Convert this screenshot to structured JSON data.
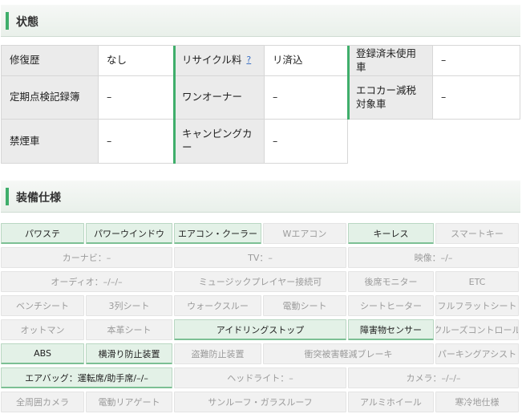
{
  "status_section": {
    "title": "状態"
  },
  "status_rows": [
    [
      {
        "label": "修復歴",
        "value": "なし"
      },
      {
        "label": "リサイクル料",
        "help": "?",
        "value": "リ済込"
      },
      {
        "label": "登録済未使用車",
        "value": "–"
      }
    ],
    [
      {
        "label": "定期点検記録簿",
        "value": "–"
      },
      {
        "label": "ワンオーナー",
        "value": "–"
      },
      {
        "label": "エコカー減税対象車",
        "value": "–"
      }
    ],
    [
      {
        "label": "禁煙車",
        "value": "–"
      },
      {
        "label": "キャンピングカー",
        "value": "–"
      }
    ]
  ],
  "equipment_section": {
    "title": "装備仕様"
  },
  "equipment_rows": [
    [
      {
        "label": "パワステ",
        "active": true
      },
      {
        "label": "パワーウインドウ",
        "active": true
      },
      {
        "label": "エアコン・クーラー",
        "active": true
      },
      {
        "label": "Wエアコン",
        "active": false
      },
      {
        "label": "キーレス",
        "active": true
      },
      {
        "label": "スマートキー",
        "active": false
      }
    ],
    [
      {
        "label": "カーナビ：–",
        "active": false
      },
      {
        "label": "TV：–",
        "active": false
      },
      {
        "label": "映像：–/–",
        "active": false
      }
    ],
    [
      {
        "label": "オーディオ：–/–/–",
        "active": false
      },
      {
        "label": "ミュージックプレイヤー接続可",
        "active": false
      },
      {
        "label": "後席モニター",
        "active": false
      },
      {
        "label": "ETC",
        "active": false
      }
    ],
    [
      {
        "label": "ベンチシート",
        "active": false
      },
      {
        "label": "3列シート",
        "active": false
      },
      {
        "label": "ウォークスルー",
        "active": false
      },
      {
        "label": "電動シート",
        "active": false
      },
      {
        "label": "シートヒーター",
        "active": false
      },
      {
        "label": "フルフラットシート",
        "active": false
      }
    ],
    [
      {
        "label": "オットマン",
        "active": false
      },
      {
        "label": "本革シート",
        "active": false
      },
      {
        "label": "アイドリングストップ",
        "active": true
      },
      {
        "label": "障害物センサー",
        "active": true
      },
      {
        "label": "クルーズコントロール",
        "active": false
      }
    ],
    [
      {
        "label": "ABS",
        "active": true
      },
      {
        "label": "横滑り防止装置",
        "active": true
      },
      {
        "label": "盗難防止装置",
        "active": false
      },
      {
        "label": "衝突被害軽減ブレーキ",
        "active": false
      },
      {
        "label": "パーキングアシスト",
        "active": false
      }
    ],
    [
      {
        "label": "エアバッグ：運転席/助手席/–/–",
        "active": true
      },
      {
        "label": "ヘッドライト：–",
        "active": false
      },
      {
        "label": "カメラ：–/–/–",
        "active": false
      }
    ],
    [
      {
        "label": "全周囲カメラ",
        "active": false
      },
      {
        "label": "電動リアゲート",
        "active": false
      },
      {
        "label": "サンルーフ・ガラスルーフ",
        "active": false
      },
      {
        "label": "アルミホイール",
        "active": false
      },
      {
        "label": "寒冷地仕様",
        "active": false
      }
    ]
  ]
}
